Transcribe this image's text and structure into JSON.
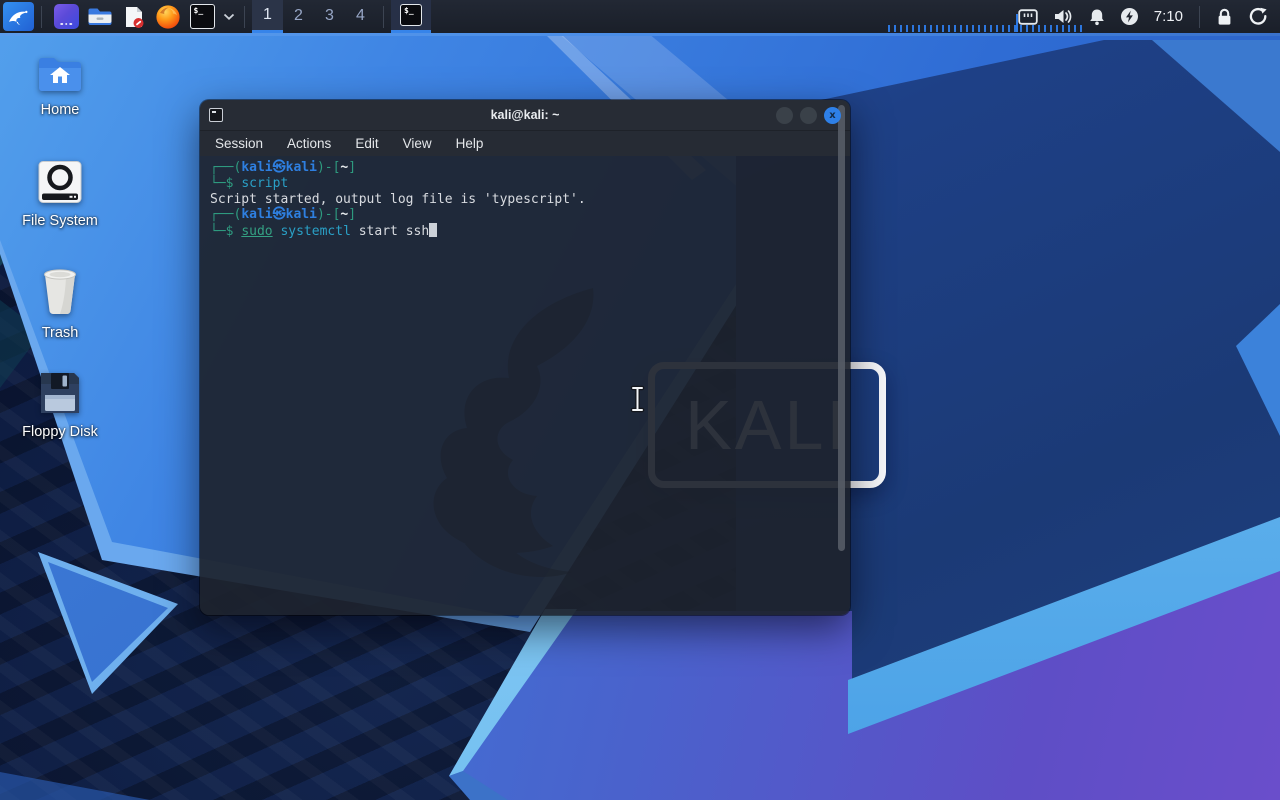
{
  "panel": {
    "start_button": {
      "icon": "kali-dragon-icon"
    },
    "launchers": [
      {
        "icon": "app-window-icon"
      },
      {
        "icon": "file-manager-icon"
      },
      {
        "icon": "text-editor-icon"
      },
      {
        "icon": "firefox-icon"
      },
      {
        "icon": "terminal-icon"
      }
    ],
    "terminal_glyph": "$_",
    "workspaces": [
      "1",
      "2",
      "3",
      "4"
    ],
    "active_workspace": "1",
    "window_list": [
      {
        "icon": "terminal-icon",
        "active": true
      }
    ],
    "tray": {
      "icons": [
        "network-icon",
        "volume-icon",
        "notifications-icon",
        "power-icon"
      ],
      "clock": "7:10",
      "session_icons": [
        "lock-icon",
        "logout-icon"
      ]
    }
  },
  "desktop": {
    "icons": [
      {
        "label": "Home",
        "icon": "home-folder-icon"
      },
      {
        "label": "File System",
        "icon": "file-system-icon"
      },
      {
        "label": "Trash",
        "icon": "trash-icon"
      },
      {
        "label": "Floppy Disk",
        "icon": "floppy-disk-icon"
      }
    ],
    "wallpaper_watermark": "KALI"
  },
  "window": {
    "title": "kali@kali: ~",
    "titlebar_icon": "terminal-icon",
    "controls": [
      "minimize",
      "maximize",
      "close"
    ],
    "close_glyph": "x",
    "menu": [
      "Session",
      "Actions",
      "Edit",
      "View",
      "Help"
    ],
    "terminal": {
      "lines": [
        {
          "segments": [
            {
              "text": "┌──(",
              "style": "frame"
            },
            {
              "text": "kali㉿kali",
              "style": "user"
            },
            {
              "text": ")-[",
              "style": "frame"
            },
            {
              "text": "~",
              "style": "path"
            },
            {
              "text": "]",
              "style": "frame"
            }
          ]
        },
        {
          "segments": [
            {
              "text": "└─$ ",
              "style": "frame"
            },
            {
              "text": "script",
              "style": "command"
            }
          ]
        },
        {
          "segments": [
            {
              "text": "Script started, output log file is 'typescript'.",
              "style": "plain"
            }
          ]
        },
        {
          "segments": [
            {
              "text": "┌──(",
              "style": "frame"
            },
            {
              "text": "kali㉿kali",
              "style": "user"
            },
            {
              "text": ")-[",
              "style": "frame"
            },
            {
              "text": "~",
              "style": "path"
            },
            {
              "text": "]",
              "style": "frame"
            }
          ]
        },
        {
          "segments": [
            {
              "text": "└─$ ",
              "style": "frame"
            },
            {
              "text": "sudo",
              "style": "sudo"
            },
            {
              "text": " ",
              "style": "plain"
            },
            {
              "text": "systemctl",
              "style": "command"
            },
            {
              "text": " start ssh",
              "style": "plain"
            },
            {
              "text": "",
              "style": "cursor"
            }
          ]
        }
      ]
    }
  },
  "colors": {
    "accent_blue": "#3684ea",
    "close_button": "#2e80e8",
    "prompt_frame": "#2e9a7f",
    "prompt_user": "#2e7fe0",
    "command_text": "#2aa0c6",
    "sudo_text": "#34a183",
    "terminal_bg": "#242936",
    "panel_bg": "#1d222c"
  }
}
